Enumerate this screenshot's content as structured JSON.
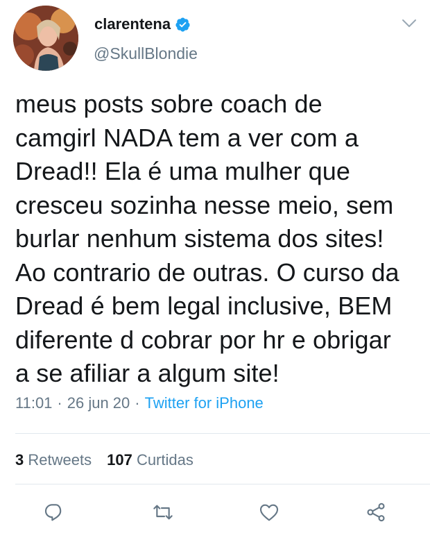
{
  "user": {
    "display_name": "clarentena",
    "handle": "@SkullBlondie",
    "verified": true
  },
  "tweet": {
    "text": "meus posts sobre coach de\ncamgirl NADA tem a ver com a\nDread!! Ela é uma mulher que\ncresceu sozinha nesse meio, sem\nburlar nenhum sistema dos sites!\nAo contrario de outras. O curso da\nDread é bem legal inclusive, BEM\ndiferente d cobrar por hr e obrigar\na se afiliar a algum site!",
    "time": "11:01",
    "date": "26 jun 20",
    "separator": "·",
    "source": "Twitter for iPhone"
  },
  "stats": {
    "retweets_count": "3",
    "retweets_label": "Retweets",
    "likes_count": "107",
    "likes_label": "Curtidas"
  },
  "icons": {
    "verified": "verified-badge-icon",
    "menu": "chevron-down-icon",
    "reply": "reply-icon",
    "retweet": "retweet-icon",
    "like": "heart-icon",
    "share": "share-icon"
  },
  "colors": {
    "accent": "#1da1f2",
    "text": "#14171a",
    "secondary": "#657786",
    "divider": "#e1e8ed"
  }
}
